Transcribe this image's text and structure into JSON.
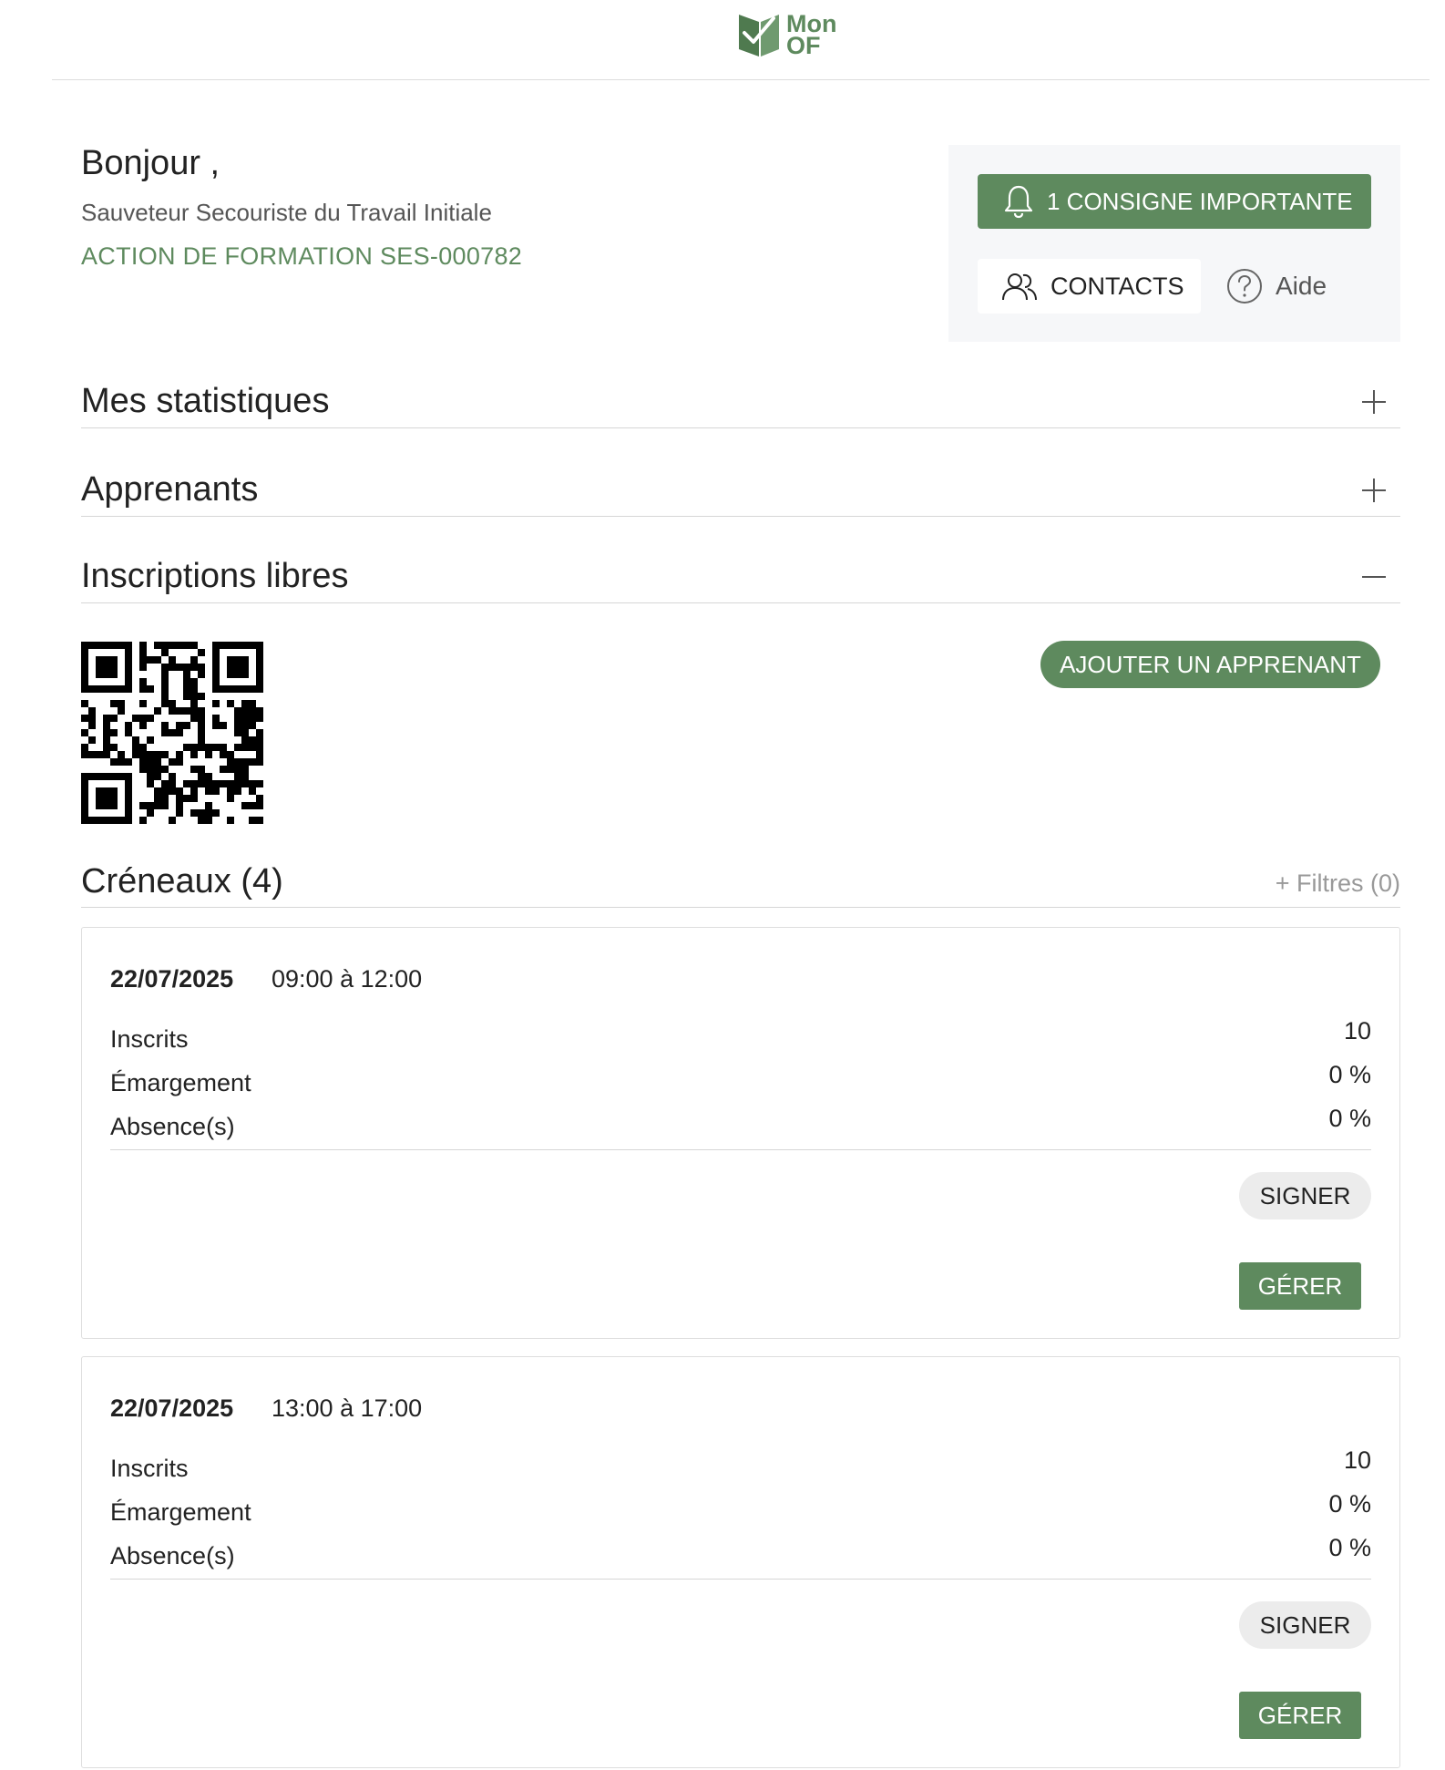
{
  "brand": {
    "logo_line1": "Mon",
    "logo_line2": "OF",
    "color": "#5e8a5e"
  },
  "header": {
    "greeting": "Bonjour ,",
    "course_name": "Sauveteur Secouriste du Travail Initiale",
    "action_reference": "ACTION DE FORMATION SES-000782"
  },
  "side_panel": {
    "consigne_label": "1 CONSIGNE IMPORTANTE",
    "consigne_icon": "bell-icon",
    "contacts_label": "CONTACTS",
    "contacts_icon": "users-icon",
    "help_label": "Aide",
    "help_icon": "question-circle-icon"
  },
  "sections": {
    "stats": {
      "title": "Mes statistiques",
      "expanded": false
    },
    "learners": {
      "title": "Apprenants",
      "expanded": false
    },
    "free_registration": {
      "title": "Inscriptions libres",
      "expanded": true
    }
  },
  "free_registration": {
    "add_learner_label": "AJOUTER UN APPRENANT"
  },
  "slots": {
    "title": "Créneaux (4)",
    "filters_label": "+ Filtres (0)",
    "items": [
      {
        "date": "22/07/2025",
        "time": "09:00 à 12:00",
        "registered_label": "Inscrits",
        "registered_value": "10",
        "attendance_label": "Émargement",
        "attendance_value": "0 %",
        "absence_label": "Absence(s)",
        "absence_value": "0 %",
        "sign_label": "SIGNER",
        "manage_label": "GÉRER"
      },
      {
        "date": "22/07/2025",
        "time": "13:00 à 17:00",
        "registered_label": "Inscrits",
        "registered_value": "10",
        "attendance_label": "Émargement",
        "attendance_value": "0 %",
        "absence_label": "Absence(s)",
        "absence_value": "0 %",
        "sign_label": "SIGNER",
        "manage_label": "GÉRER"
      }
    ]
  }
}
